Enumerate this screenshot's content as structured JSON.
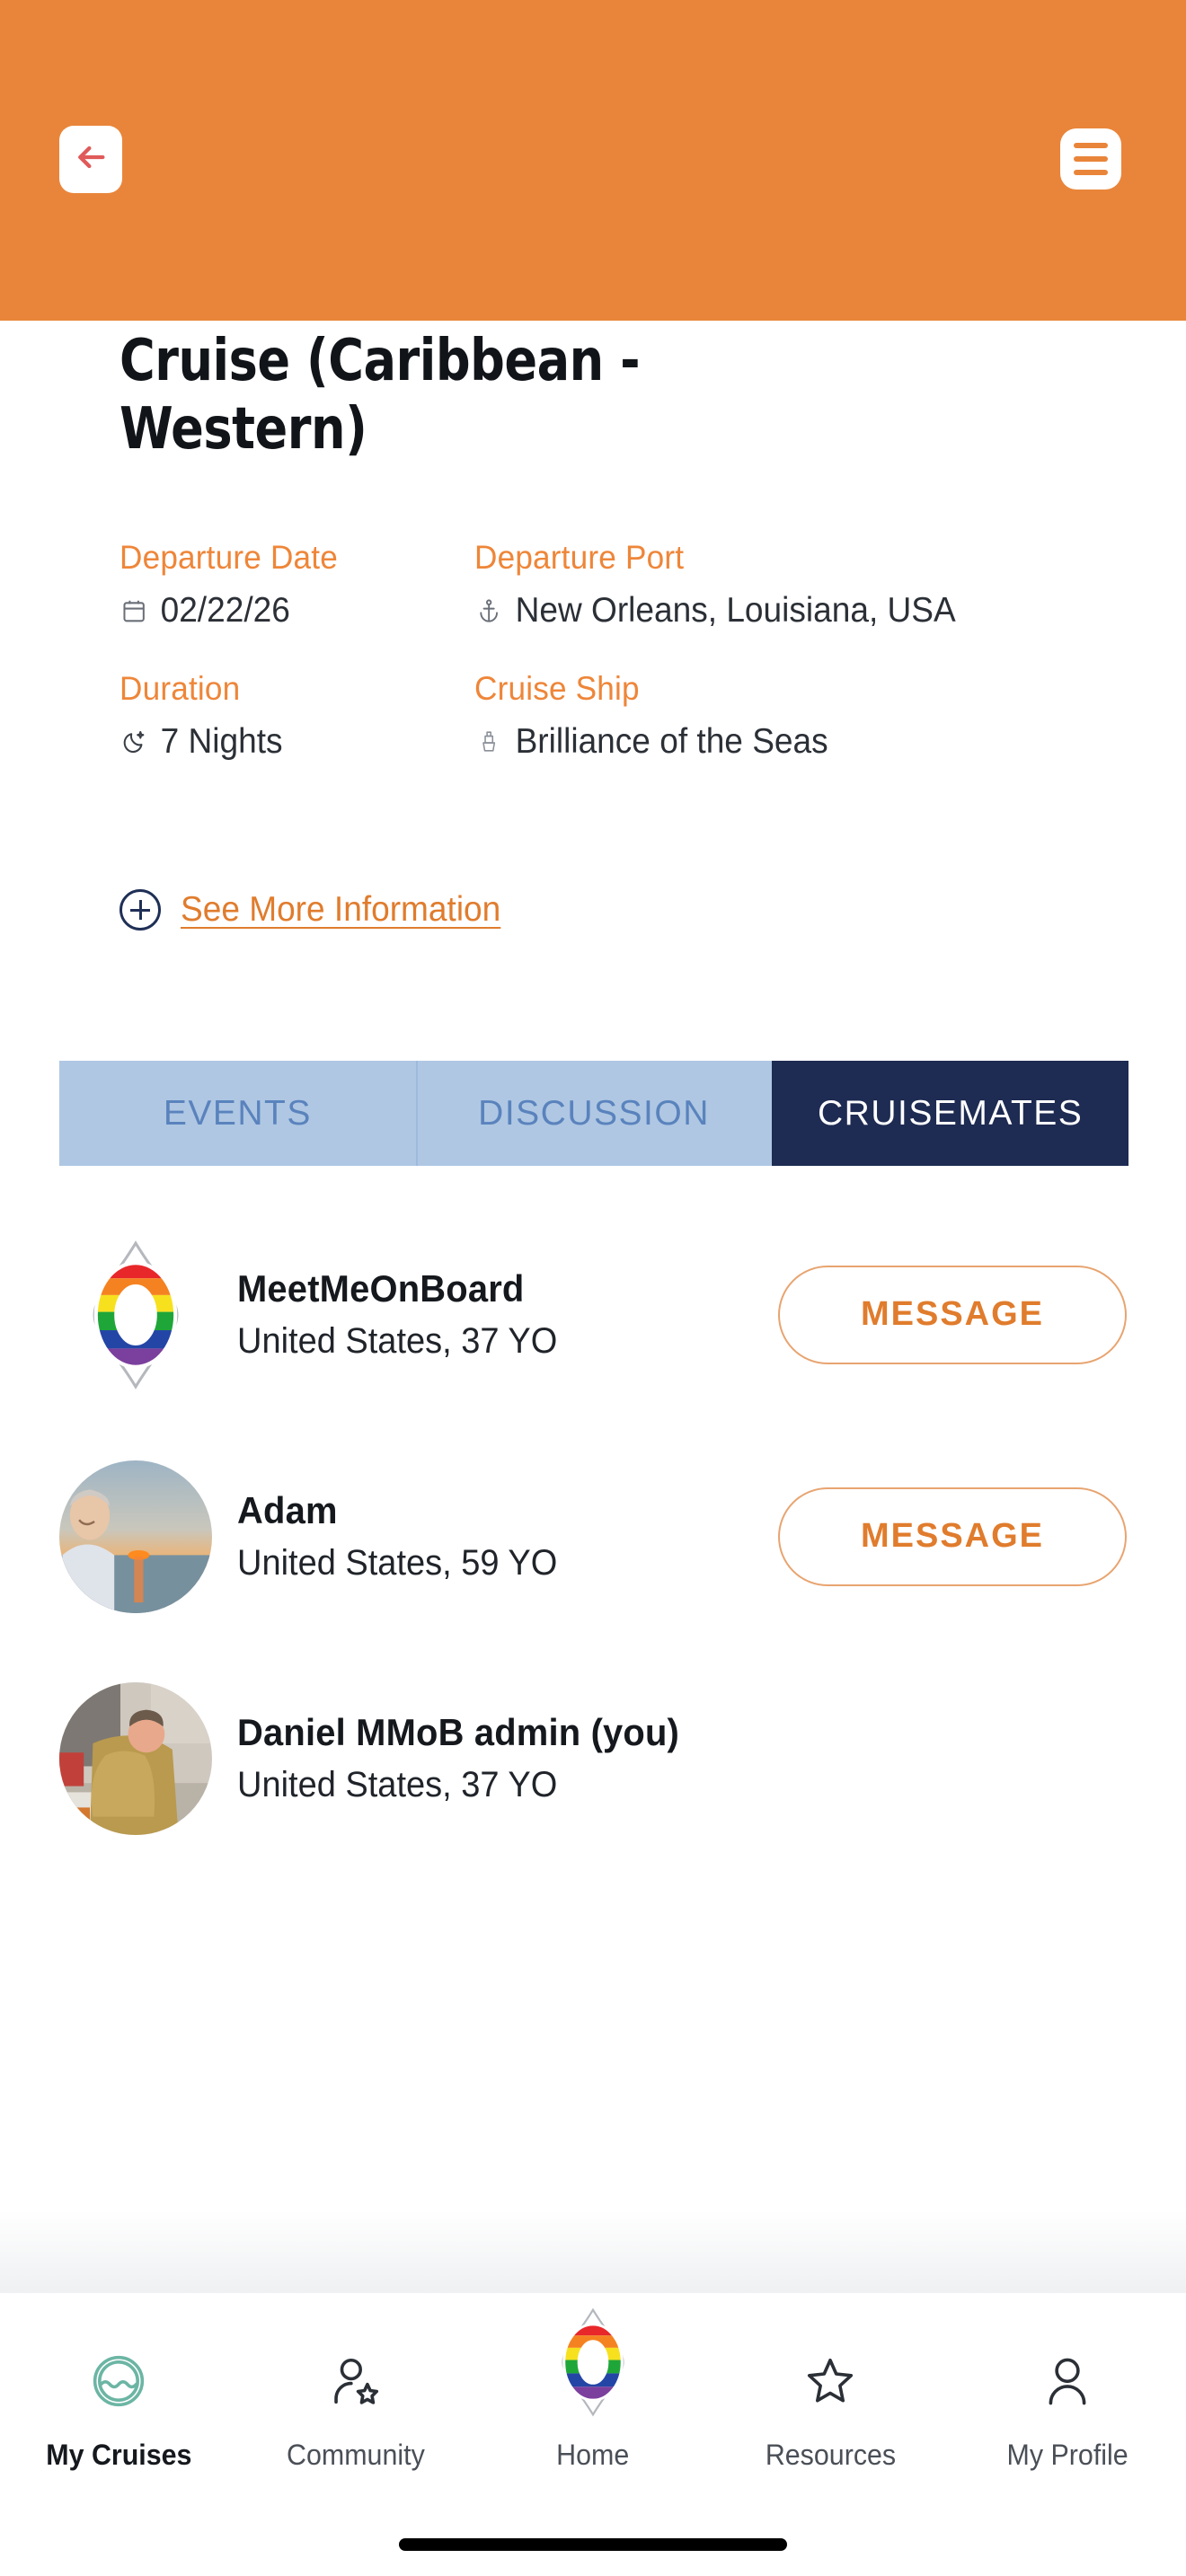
{
  "theme": {
    "orange": "#e9853a",
    "link_orange": "#e07c2d",
    "navy": "#1e2b52",
    "tab_inactive_bg": "#afc7e3",
    "tab_inactive_text": "#5a83bd",
    "teal": "#6cb5a4",
    "back_arrow_red": "#e05a5a"
  },
  "header": {
    "back_icon": "arrow-left-icon",
    "menu_icon": "hamburger-menu-icon"
  },
  "page": {
    "title": "Cruise (Caribbean - Western)"
  },
  "details": [
    {
      "label": "Departure Date",
      "value": "02/22/26",
      "icon": "calendar-icon"
    },
    {
      "label": "Departure Port",
      "value": "New Orleans, Louisiana, USA",
      "icon": "anchor-icon"
    },
    {
      "label": "Duration",
      "value": "7 Nights",
      "icon": "moon-star-icon"
    },
    {
      "label": "Cruise Ship",
      "value": "Brilliance of the Seas",
      "icon": "cruise-ship-icon"
    }
  ],
  "see_more": {
    "label": "See More Information",
    "icon": "plus-circle-icon"
  },
  "tabs": [
    {
      "label": "EVENTS",
      "active": false
    },
    {
      "label": "DISCUSSION",
      "active": false
    },
    {
      "label": "CRUISEMATES",
      "active": true
    }
  ],
  "cruisemates": [
    {
      "name": "MeetMeOnBoard",
      "meta": "United States, 37 YO",
      "avatar": "rainbow-lifering-logo",
      "action_label": "MESSAGE",
      "has_action": true
    },
    {
      "name": "Adam",
      "meta": "United States, 59 YO",
      "avatar": "sunset-portrait-photo",
      "action_label": "MESSAGE",
      "has_action": true
    },
    {
      "name": "Daniel MMoB admin (you)",
      "meta": "United States, 37 YO",
      "avatar": "indoor-portrait-photo",
      "action_label": "",
      "has_action": false
    }
  ],
  "bottom_nav": [
    {
      "label": "My Cruises",
      "icon": "wave-circle-icon",
      "active": true
    },
    {
      "label": "Community",
      "icon": "person-star-icon",
      "active": false
    },
    {
      "label": "Home",
      "icon": "rainbow-lifering-icon",
      "active": false
    },
    {
      "label": "Resources",
      "icon": "star-icon",
      "active": false
    },
    {
      "label": "My Profile",
      "icon": "person-icon",
      "active": false
    }
  ]
}
